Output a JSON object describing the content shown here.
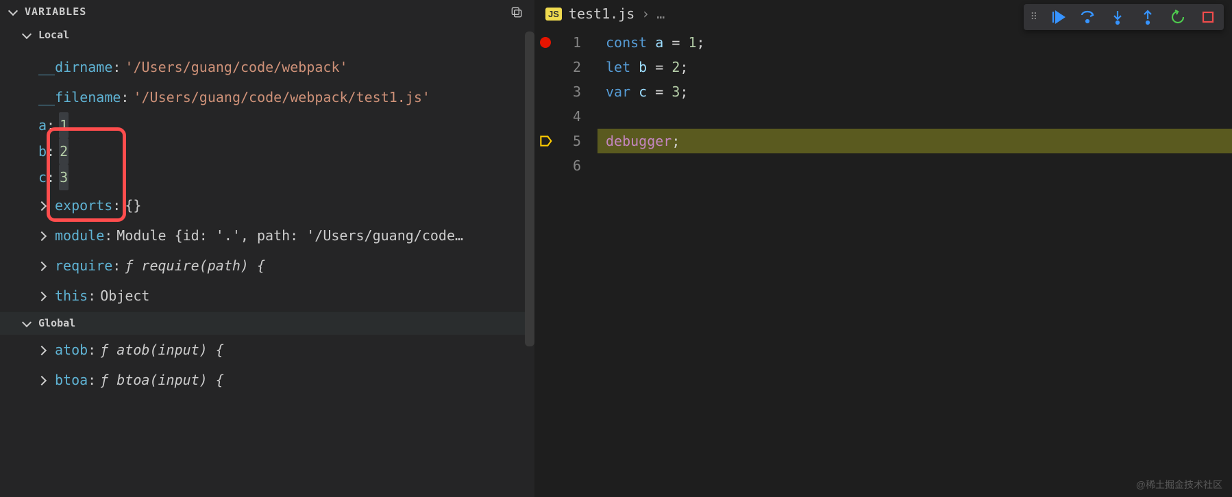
{
  "variables_panel": {
    "title": "VARIABLES",
    "scopes": {
      "local": {
        "label": "Local",
        "vars": {
          "dirname": {
            "name": "__dirname",
            "value": "'/Users/guang/code/webpack'"
          },
          "filename": {
            "name": "__filename",
            "value": "'/Users/guang/code/webpack/test1.js'"
          },
          "a": {
            "name": "a",
            "value": "1"
          },
          "b": {
            "name": "b",
            "value": "2"
          },
          "c": {
            "name": "c",
            "value": "3"
          },
          "exports": {
            "name": "exports",
            "value": "{}"
          },
          "module": {
            "name": "module",
            "value": "Module {id: '.', path: '/Users/guang/code…"
          },
          "require": {
            "name": "require",
            "value": "ƒ require(path) {"
          },
          "this": {
            "name": "this",
            "value": "Object"
          }
        }
      },
      "global": {
        "label": "Global",
        "vars": {
          "atob": {
            "name": "atob",
            "value": "ƒ atob(input) {"
          },
          "btoa": {
            "name": "btoa",
            "value": "ƒ btoa(input) {"
          }
        }
      }
    }
  },
  "editor": {
    "filename": "test1.js",
    "breadcrumb_extra": "…",
    "breakpoint_line": 1,
    "current_line": 5,
    "lines": {
      "1": {
        "tokens": [
          [
            "kw",
            "const"
          ],
          [
            "sp",
            " "
          ],
          [
            "var",
            "a"
          ],
          [
            "sp",
            " "
          ],
          [
            "op",
            "="
          ],
          [
            "sp",
            " "
          ],
          [
            "num",
            "1"
          ],
          [
            "punc",
            ";"
          ]
        ]
      },
      "2": {
        "tokens": [
          [
            "kw",
            "let"
          ],
          [
            "sp",
            " "
          ],
          [
            "var",
            "b"
          ],
          [
            "sp",
            " "
          ],
          [
            "op",
            "="
          ],
          [
            "sp",
            " "
          ],
          [
            "num",
            "2"
          ],
          [
            "punc",
            ";"
          ]
        ]
      },
      "3": {
        "tokens": [
          [
            "kw",
            "var"
          ],
          [
            "sp",
            " "
          ],
          [
            "var",
            "c"
          ],
          [
            "sp",
            " "
          ],
          [
            "op",
            "="
          ],
          [
            "sp",
            " "
          ],
          [
            "num",
            "3"
          ],
          [
            "punc",
            ";"
          ]
        ]
      },
      "4": {
        "tokens": []
      },
      "5": {
        "tokens": [
          [
            "debugger",
            "debugger"
          ],
          [
            "punc",
            ";"
          ]
        ]
      },
      "6": {
        "tokens": []
      }
    }
  },
  "watermark": "@稀土掘金技术社区"
}
